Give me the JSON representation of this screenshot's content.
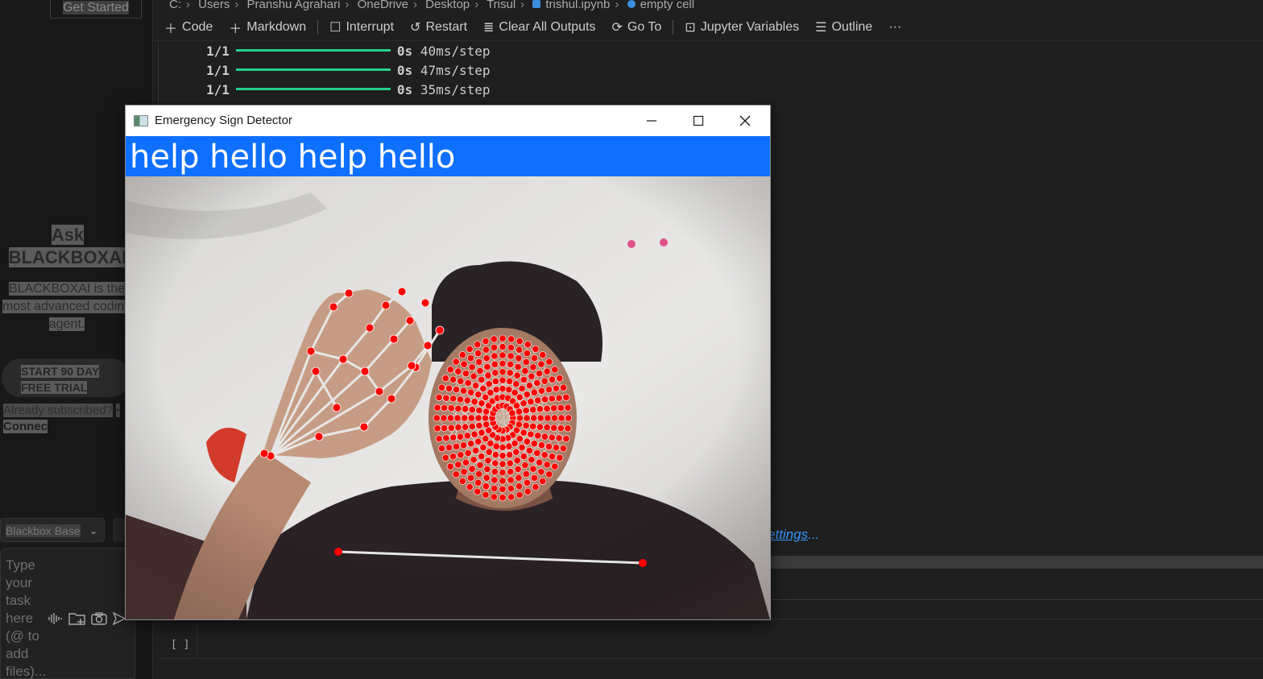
{
  "sidebar": {
    "get_started": "Get Started",
    "ask_title_line1": "Ask",
    "ask_title_line2": "BLACKBOXAI",
    "description": "BLACKBOXAI is the most advanced coding agent.",
    "trial_button": "START 90 DAY FREE TRIAL",
    "already_subscribed": "Already subscribed?",
    "bullet": "•",
    "connect": "Connec",
    "model_select": "Blackbox Base",
    "task_placeholder": "Type your task here (@ to add files)..."
  },
  "breadcrumb": [
    "C:",
    "Users",
    "Pranshu Agrahari",
    "OneDrive",
    "Desktop",
    "Trisul",
    "trishul.ipynb",
    "empty cell"
  ],
  "toolbar": {
    "code": "Code",
    "markdown": "Markdown",
    "interrupt": "Interrupt",
    "restart": "Restart",
    "clear_outputs": "Clear All Outputs",
    "go_to": "Go To",
    "variables": "Jupyter Variables",
    "outline": "Outline",
    "more": "···"
  },
  "output": {
    "lines": [
      {
        "step": "1/1",
        "time": "0s",
        "rate": "40ms/step"
      },
      {
        "step": "1/1",
        "time": "0s",
        "rate": "47ms/step"
      },
      {
        "step": "1/1",
        "time": "0s",
        "rate": "35ms/step"
      }
    ],
    "settings_link": "ettings",
    "settings_ellipsis": "..."
  },
  "cell": {
    "exec_label": "[ ]"
  },
  "cv_window": {
    "title": "Emergency Sign Detector",
    "banner_text": "help  hello  help  hello",
    "banner_color": "#0f6fff",
    "landmark_color": "#ff0000"
  }
}
